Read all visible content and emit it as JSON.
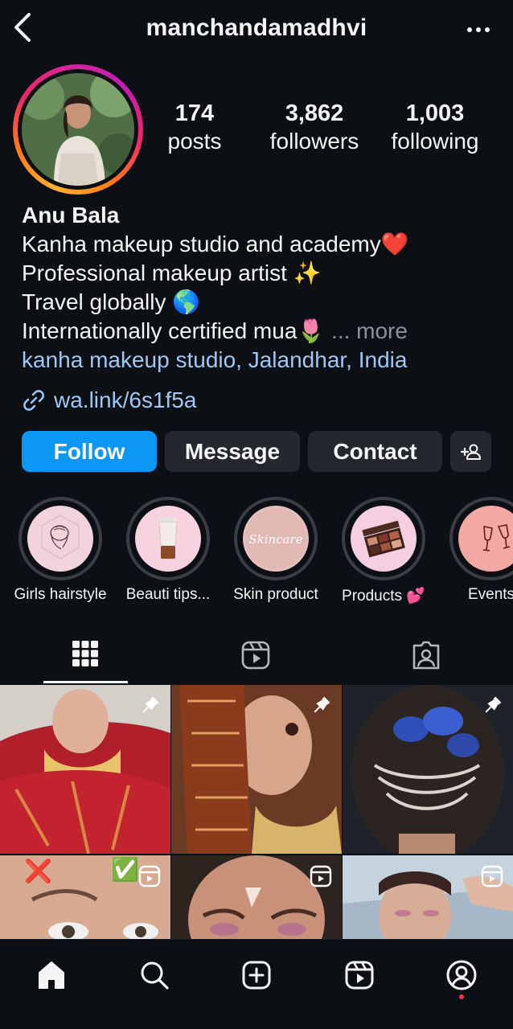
{
  "header": {
    "username": "manchandamadhvi",
    "back_icon": "chevron-left-icon",
    "more_icon": "more-horizontal-icon"
  },
  "stats": [
    {
      "value": "174",
      "label": "posts"
    },
    {
      "value": "3,862",
      "label": "followers"
    },
    {
      "value": "1,003",
      "label": "following"
    }
  ],
  "bio": {
    "name": "Anu Bala",
    "line1": "Kanha makeup studio and academy❤️",
    "line2": "Professional makeup artist ✨",
    "line3": "Travel globally 🌎",
    "line4": " Internationally certified mua🌷",
    "more": "... more",
    "location": "kanha makeup studio, Jalandhar, India",
    "link": "wa.link/6s1f5a"
  },
  "buttons": {
    "follow": "Follow",
    "message": "Message",
    "contact": "Contact"
  },
  "highlights": [
    {
      "label": "Girls hairstyle",
      "icon": "hairstyle-sketch-icon"
    },
    {
      "label": "Beauti tips...",
      "icon": "cosmetic-tube-icon"
    },
    {
      "label": "Skin product",
      "icon": "skincare-text-icon"
    },
    {
      "label": "Products 💕",
      "icon": "eyeshadow-palette-icon"
    },
    {
      "label": "Events",
      "icon": "cheers-glasses-icon"
    }
  ],
  "tabs": [
    "grid-icon",
    "reels-icon",
    "tagged-icon"
  ],
  "grid": [
    {
      "type": "pinned"
    },
    {
      "type": "pinned"
    },
    {
      "type": "pinned"
    },
    {
      "type": "reel",
      "mark_left": "❌",
      "mark_right": "✅"
    },
    {
      "type": "reel"
    },
    {
      "type": "reel"
    }
  ],
  "nav": [
    "home-icon",
    "search-icon",
    "create-icon",
    "reels-icon",
    "profile-icon"
  ],
  "colors": {
    "background": "#0c0f14",
    "follow": "#0b97f5",
    "link": "#9fc8f5",
    "button": "#24272e"
  }
}
